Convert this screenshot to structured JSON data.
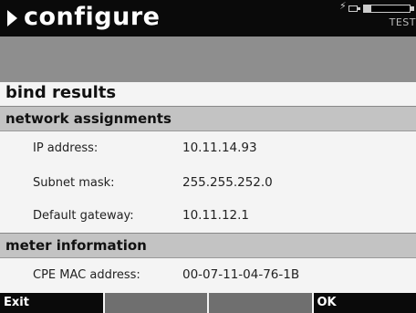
{
  "header": {
    "title": "configure",
    "status": {
      "indicator_text": "TEST",
      "battery_level": 0.15,
      "icons": [
        "charging-bolt-icon",
        "plug-icon",
        "battery-icon"
      ]
    }
  },
  "page": {
    "title": "bind results"
  },
  "sections": {
    "network": {
      "header": "network assignments",
      "rows": [
        {
          "label": "IP address:",
          "value": "10.11.14.93"
        },
        {
          "label": "Subnet mask:",
          "value": "255.255.252.0"
        },
        {
          "label": "Default gateway:",
          "value": "10.11.12.1"
        }
      ]
    },
    "meter": {
      "header": "meter information",
      "rows": [
        {
          "label": "CPE MAC address:",
          "value": "00-07-11-04-76-1B"
        }
      ]
    }
  },
  "softkeys": {
    "key1": "Exit",
    "key2": "",
    "key3": "",
    "key4": "OK"
  },
  "colors": {
    "titlebar": "#0a0a0a",
    "subbar": "#8e8e8e",
    "section_header": "#c3c3c3",
    "background": "#f4f4f4",
    "softkey_blank": "#6f6f6f"
  }
}
